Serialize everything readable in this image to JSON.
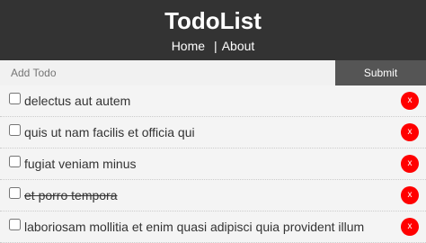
{
  "app": {
    "title": "TodoList"
  },
  "nav": {
    "home": "Home",
    "separator": "|",
    "about": "About"
  },
  "form": {
    "placeholder": "Add Todo",
    "value": "",
    "submit_label": "Submit"
  },
  "colors": {
    "header_bg": "#333333",
    "submit_bg": "#555555",
    "delete_bg": "#ff0000"
  },
  "todos": [
    {
      "title": "delectus aut autem",
      "completed": false,
      "delete_label": "x"
    },
    {
      "title": "quis ut nam facilis et officia qui",
      "completed": false,
      "delete_label": "x"
    },
    {
      "title": "fugiat veniam minus",
      "completed": false,
      "delete_label": "x"
    },
    {
      "title": "et porro tempora",
      "completed": true,
      "delete_label": "x"
    },
    {
      "title": "laboriosam mollitia et enim quasi adipisci quia provident illum",
      "completed": false,
      "delete_label": "x"
    }
  ]
}
